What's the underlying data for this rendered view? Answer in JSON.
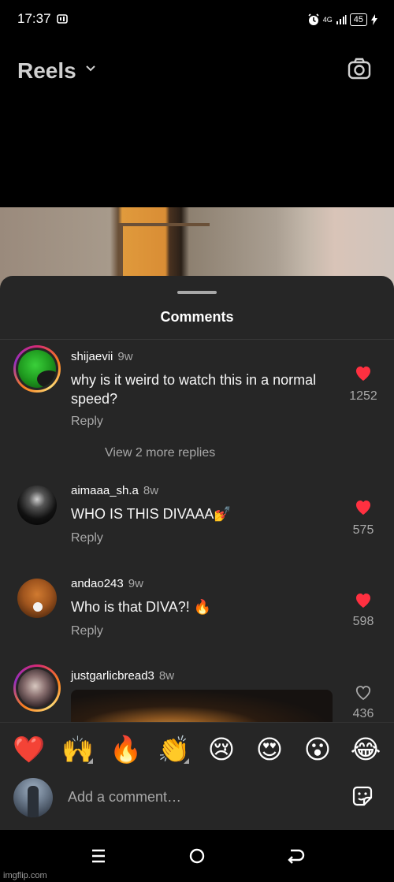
{
  "status": {
    "time": "17:37",
    "network": "4G",
    "battery": "45"
  },
  "header": {
    "title": "Reels"
  },
  "sheet": {
    "title": "Comments"
  },
  "comments": [
    {
      "username": "shijaevii",
      "time": "9w",
      "text": "why is it weird to watch this in a normal speed?",
      "reply": "Reply",
      "likes": "1252",
      "liked": true,
      "view_more": "View 2 more replies"
    },
    {
      "username": "aimaaa_sh.a",
      "time": "8w",
      "text": "WHO IS THIS DIVAAA💅",
      "reply": "Reply",
      "likes": "575",
      "liked": true
    },
    {
      "username": "andao243",
      "time": "9w",
      "text": "Who is that DIVA?! 🔥",
      "reply": "Reply",
      "likes": "598",
      "liked": true
    },
    {
      "username": "justgarlicbread3",
      "time": "8w",
      "likes": "436",
      "liked": false
    }
  ],
  "reactions": [
    "❤️",
    "🙌",
    "🔥",
    "👏",
    "😢",
    "😍",
    "😮",
    "😂"
  ],
  "input": {
    "placeholder": "Add a comment…"
  },
  "watermark": "imgflip.com",
  "colors": {
    "like_red": "#ff3040",
    "sheet_bg": "#262626",
    "muted": "#a8a8a8"
  }
}
